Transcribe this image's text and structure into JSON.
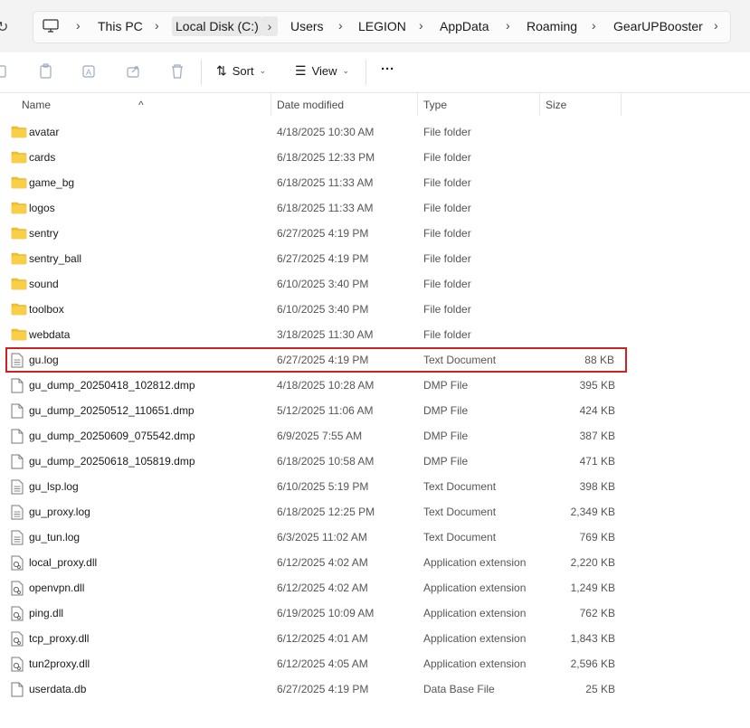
{
  "breadcrumb": [
    {
      "label": "This PC"
    },
    {
      "label": "Local Disk (C:)"
    },
    {
      "label": "Users"
    },
    {
      "label": "LEGION"
    },
    {
      "label": "AppData"
    },
    {
      "label": "Roaming"
    },
    {
      "label": "GearUPBooster"
    }
  ],
  "toolbar": {
    "sort_label": "Sort",
    "view_label": "View",
    "more_label": "···"
  },
  "columns": {
    "name": "Name",
    "date": "Date modified",
    "type": "Type",
    "size": "Size"
  },
  "files": [
    {
      "name": "avatar",
      "date": "4/18/2025 10:30 AM",
      "type": "File folder",
      "size": "",
      "icon": "folder-icon"
    },
    {
      "name": "cards",
      "date": "6/18/2025 12:33 PM",
      "type": "File folder",
      "size": "",
      "icon": "folder-icon"
    },
    {
      "name": "game_bg",
      "date": "6/18/2025 11:33 AM",
      "type": "File folder",
      "size": "",
      "icon": "folder-icon"
    },
    {
      "name": "logos",
      "date": "6/18/2025 11:33 AM",
      "type": "File folder",
      "size": "",
      "icon": "folder-icon"
    },
    {
      "name": "sentry",
      "date": "6/27/2025 4:19 PM",
      "type": "File folder",
      "size": "",
      "icon": "folder-icon"
    },
    {
      "name": "sentry_ball",
      "date": "6/27/2025 4:19 PM",
      "type": "File folder",
      "size": "",
      "icon": "folder-icon"
    },
    {
      "name": "sound",
      "date": "6/10/2025 3:40 PM",
      "type": "File folder",
      "size": "",
      "icon": "folder-icon"
    },
    {
      "name": "toolbox",
      "date": "6/10/2025 3:40 PM",
      "type": "File folder",
      "size": "",
      "icon": "folder-icon"
    },
    {
      "name": "webdata",
      "date": "3/18/2025 11:30 AM",
      "type": "File folder",
      "size": "",
      "icon": "folder-icon"
    },
    {
      "name": "gu.log",
      "date": "6/27/2025 4:19 PM",
      "type": "Text Document",
      "size": "88 KB",
      "icon": "text-file-icon",
      "highlighted": true
    },
    {
      "name": "gu_dump_20250418_102812.dmp",
      "date": "4/18/2025 10:28 AM",
      "type": "DMP File",
      "size": "395 KB",
      "icon": "file-icon"
    },
    {
      "name": "gu_dump_20250512_110651.dmp",
      "date": "5/12/2025 11:06 AM",
      "type": "DMP File",
      "size": "424 KB",
      "icon": "file-icon"
    },
    {
      "name": "gu_dump_20250609_075542.dmp",
      "date": "6/9/2025 7:55 AM",
      "type": "DMP File",
      "size": "387 KB",
      "icon": "file-icon"
    },
    {
      "name": "gu_dump_20250618_105819.dmp",
      "date": "6/18/2025 10:58 AM",
      "type": "DMP File",
      "size": "471 KB",
      "icon": "file-icon"
    },
    {
      "name": "gu_lsp.log",
      "date": "6/10/2025 5:19 PM",
      "type": "Text Document",
      "size": "398 KB",
      "icon": "text-file-icon"
    },
    {
      "name": "gu_proxy.log",
      "date": "6/18/2025 12:25 PM",
      "type": "Text Document",
      "size": "2,349 KB",
      "icon": "text-file-icon"
    },
    {
      "name": "gu_tun.log",
      "date": "6/3/2025 11:02 AM",
      "type": "Text Document",
      "size": "769 KB",
      "icon": "text-file-icon"
    },
    {
      "name": "local_proxy.dll",
      "date": "6/12/2025 4:02 AM",
      "type": "Application extension",
      "size": "2,220 KB",
      "icon": "dll-file-icon"
    },
    {
      "name": "openvpn.dll",
      "date": "6/12/2025 4:02 AM",
      "type": "Application extension",
      "size": "1,249 KB",
      "icon": "dll-file-icon"
    },
    {
      "name": "ping.dll",
      "date": "6/19/2025 10:09 AM",
      "type": "Application extension",
      "size": "762 KB",
      "icon": "dll-file-icon"
    },
    {
      "name": "tcp_proxy.dll",
      "date": "6/12/2025 4:01 AM",
      "type": "Application extension",
      "size": "1,843 KB",
      "icon": "dll-file-icon"
    },
    {
      "name": "tun2proxy.dll",
      "date": "6/12/2025 4:05 AM",
      "type": "Application extension",
      "size": "2,596 KB",
      "icon": "dll-file-icon"
    },
    {
      "name": "userdata.db",
      "date": "6/27/2025 4:19 PM",
      "type": "Data Base File",
      "size": "25 KB",
      "icon": "file-icon"
    }
  ],
  "colors": {
    "folder": "#f4c430",
    "highlight_border": "#cc2222"
  }
}
